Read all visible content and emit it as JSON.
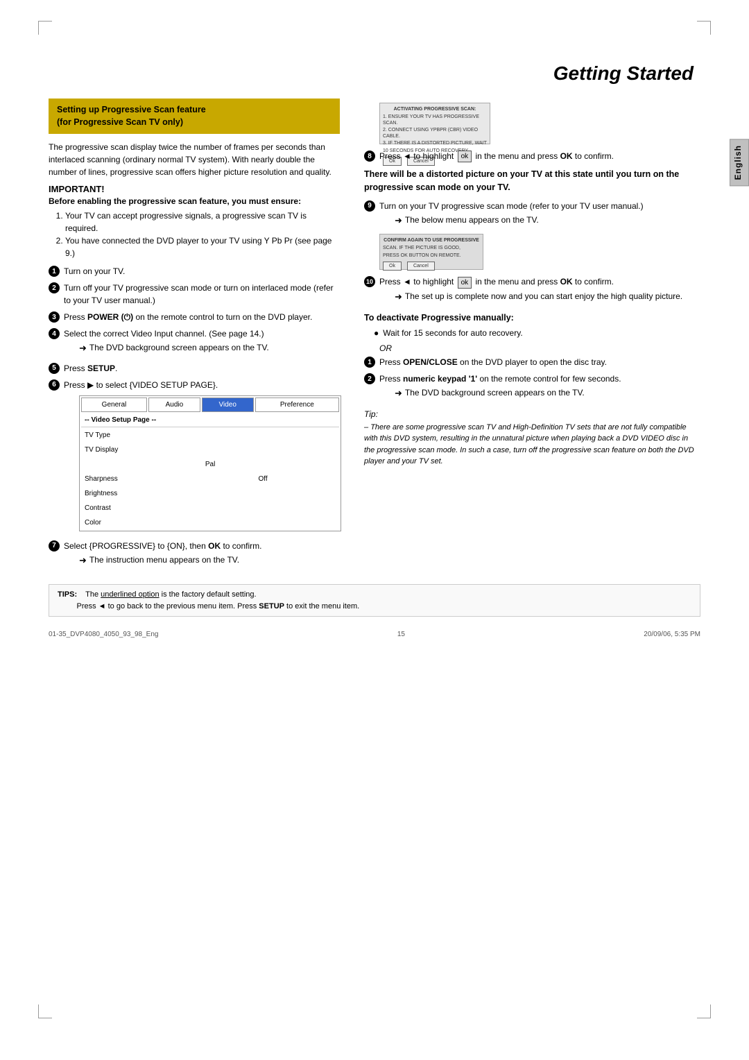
{
  "page": {
    "title": "Getting Started",
    "language_tab": "English",
    "page_number": "15",
    "footer_left": "01-35_DVP4080_4050_93_98_Eng",
    "footer_center": "15",
    "footer_right": "20/09/06, 5:35 PM"
  },
  "feature_box": {
    "title_line1": "Setting up Progressive Scan feature",
    "title_line2": "(for Progressive Scan TV only)"
  },
  "intro_text": "The progressive scan display twice the number of frames per seconds than interlaced scanning (ordinary normal TV system). With nearly double the number of lines, progressive scan offers higher picture resolution and quality.",
  "important": {
    "label": "IMPORTANT!",
    "before_text": "Before enabling the progressive scan feature, you must ensure:",
    "items": [
      "Your TV can accept progressive signals, a progressive scan TV is required.",
      "You have connected the DVD player to your TV using Y Pb Pr (see page 9.)"
    ]
  },
  "left_steps": [
    {
      "num": "1",
      "text": "Turn on your TV."
    },
    {
      "num": "2",
      "text": "Turn off your TV progressive scan mode or turn on interlaced mode (refer to your TV user manual.)"
    },
    {
      "num": "3",
      "text": "Press POWER (⏻) on the remote control to turn on the DVD player."
    },
    {
      "num": "4",
      "text": "Select the correct Video Input channel. (See page 14.)",
      "arrow": "The DVD background screen appears on the TV."
    },
    {
      "num": "5",
      "text": "Press SETUP."
    },
    {
      "num": "6",
      "text": "Press ► to select {VIDEO SETUP PAGE}.",
      "has_table": true
    },
    {
      "num": "7",
      "text": "Select {PROGRESSIVE} to {ON}, then OK to confirm.",
      "arrow": "The instruction menu appears on the TV."
    }
  ],
  "setup_table": {
    "tabs": [
      "General",
      "Audio",
      "Video",
      "Preference"
    ],
    "active_tab": "Video",
    "header_row": "-- Video Setup Page --",
    "rows": [
      {
        "label": "TV Type",
        "value": ""
      },
      {
        "label": "TV Display",
        "value": ""
      },
      {
        "label": "",
        "value": "Pal"
      },
      {
        "label": "Sharpness",
        "value": "Off"
      },
      {
        "label": "Brightness",
        "value": ""
      },
      {
        "label": "Contrast",
        "value": ""
      },
      {
        "label": "Color",
        "value": ""
      }
    ]
  },
  "screen1": {
    "title": "ACTIVATING PROGRESSIVE SCAN:",
    "lines": [
      "1. ENSURE YOUR TV HAS PROGRESSIVE SCAN.",
      "2. CONNECT USING YPBPR (CBR) VIDEO CABLE.",
      "3. IF THERE IS A DISTORTED PICTURE, WAIT",
      "   10 SECONDS FOR AUTO RECOVERY."
    ],
    "btn_ok": "Ok",
    "btn_cancel": "Cancel"
  },
  "right_steps_top": [
    {
      "num": "8",
      "text": "Press ◄ to highlight",
      "inline": "ok",
      "text_after": "in the menu and press OK to confirm."
    }
  ],
  "distorted_notice": "There will be a distorted picture on your TV at this state until you turn on the progressive scan mode on your TV.",
  "right_steps_middle": [
    {
      "num": "9",
      "text": "Turn on your TV progressive scan mode (refer to your TV user manual.)",
      "arrow": "The below menu appears on the TV."
    }
  ],
  "screen2": {
    "title": "CONFIRM AGAIN TO USE PROGRESSIVE",
    "lines": [
      "SCAN. IF THE PICTURE IS GOOD,",
      "PRESS OK BUTTON ON REMOTE."
    ],
    "btn_ok": "Ok",
    "btn_cancel": "Cancel"
  },
  "right_steps_bottom": [
    {
      "num": "10",
      "text": "Press ◄ to highlight",
      "inline": "ok",
      "text_after": "in the menu and press OK to confirm.",
      "arrow": "The set up is complete now and you can start enjoy the high quality picture."
    }
  ],
  "deactivate": {
    "heading": "To deactivate Progressive manually:",
    "bullet1": "Wait for 15 seconds for auto recovery.",
    "or_text": "OR",
    "steps": [
      {
        "num": "1",
        "text": "Press OPEN/CLOSE on the DVD player to open the disc tray."
      },
      {
        "num": "2",
        "text": "Press numeric keypad ‘1’ on the remote control for few seconds.",
        "arrow": "The DVD background screen appears on the TV."
      }
    ],
    "tip_label": "Tip:",
    "tip_text": "There are some progressive scan TV and High-Definition TV sets that are not fully compatible with this DVD system, resulting in the unnatural picture when playing back a DVD VIDEO disc in the progressive scan mode. In such a case, turn off the progressive scan feature on both the DVD player and your TV set."
  },
  "tips_box": {
    "tips_label": "TIPS:",
    "text1": "The underlined option is the factory default setting.",
    "text2": "Press ◄ to go back to the previous menu item. Press SETUP to exit the menu item."
  }
}
